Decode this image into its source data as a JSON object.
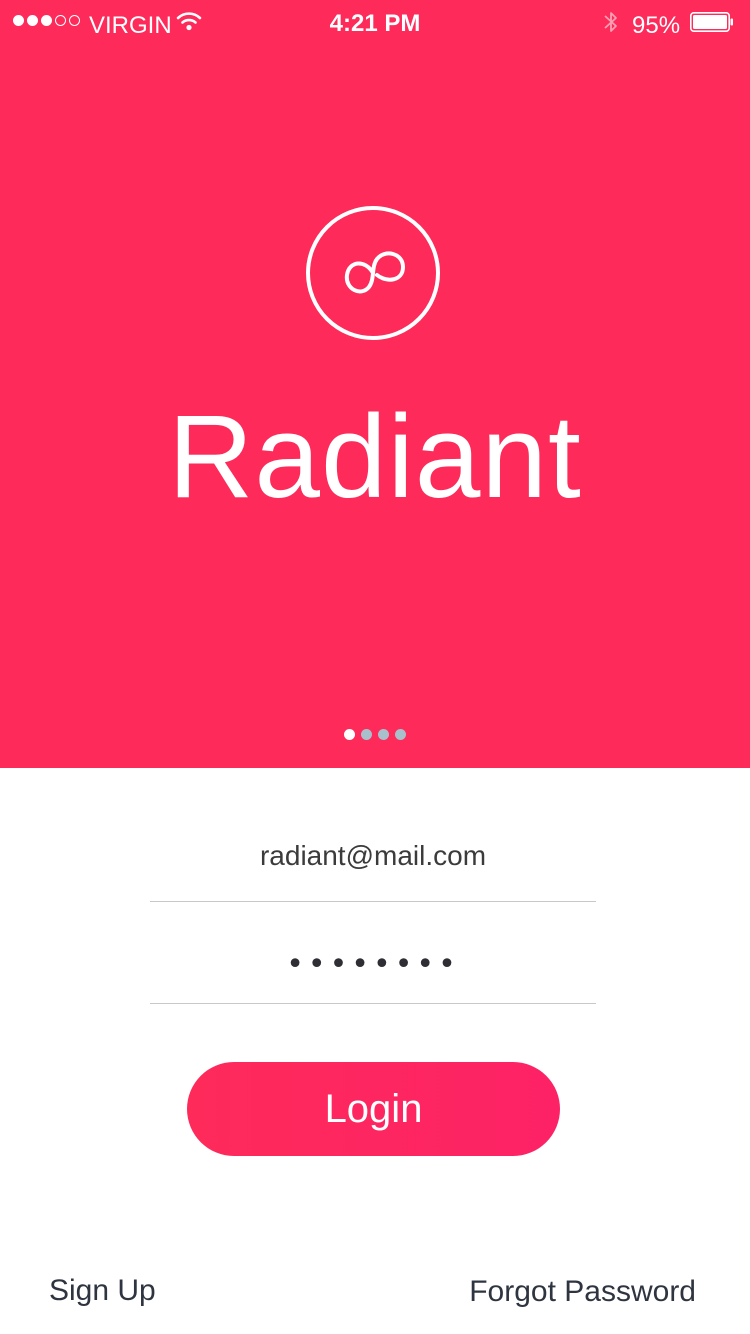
{
  "status_bar": {
    "carrier": "VIRGIN",
    "time": "4:21 PM",
    "battery_percent": "95%",
    "signal_strength": 3,
    "signal_max": 5
  },
  "hero": {
    "app_name": "Radiant",
    "logo_icon": "infinity-loop-icon",
    "background_color": "#fe2a5a",
    "page_indicator": {
      "count": 4,
      "active": 0
    }
  },
  "form": {
    "email_value": "radiant@mail.com",
    "password_value": "••••••••",
    "login_label": "Login"
  },
  "footer": {
    "signup_label": "Sign Up",
    "forgot_label": "Forgot Password"
  }
}
